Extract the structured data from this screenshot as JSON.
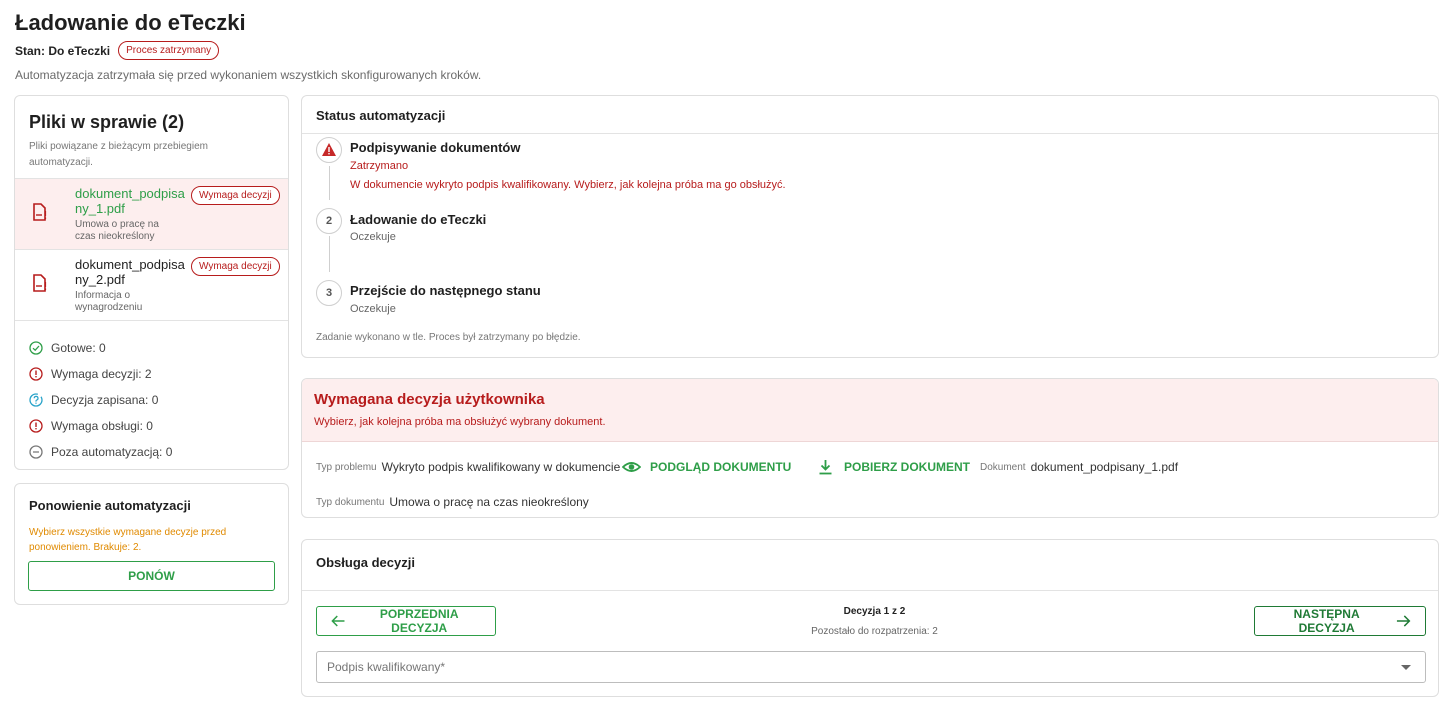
{
  "header": {
    "title": "Ładowanie do eTeczki",
    "state_label": "Stan: Do eTeczki",
    "state_chip": "Proces zatrzymany",
    "subtitle": "Automatyzacja zatrzymała się przed wykonaniem wszystkich skonfigurowanych kroków."
  },
  "files": {
    "title": "Pliki w sprawie (2)",
    "description": "Pliki powiązane z bieżącym przebiegiem automatyzacji.",
    "items": [
      {
        "name": "dokument_podpisany_1.pdf",
        "description": "Umowa o pracę na czas nieokreślony",
        "badge": "Wymaga decyzji",
        "icon": "pdf-error-icon"
      },
      {
        "name": "dokument_podpisany_2.pdf",
        "description": "Informacja o wynagrodzeniu",
        "badge": "Wymaga decyzji",
        "icon": "pdf-error-icon"
      }
    ],
    "stats": [
      {
        "label": "Gotowe: 0",
        "icon": "check-circle-icon",
        "color": "#2e9e48"
      },
      {
        "label": "Wymaga decyzji: 2",
        "icon": "alert-circle-icon",
        "color": "#b71c1c"
      },
      {
        "label": "Decyzja zapisana: 0",
        "icon": "question-circle-icon",
        "color": "#29a3c9"
      },
      {
        "label": "Wymaga obsługi: 0",
        "icon": "alert-circle-icon",
        "color": "#b71c1c"
      },
      {
        "label": "Poza automatyzacją: 0",
        "icon": "minus-circle-icon",
        "color": "#777777"
      }
    ]
  },
  "retry": {
    "title": "Ponowienie automatyzacji",
    "note": "Wybierz wszystkie wymagane decyzje przed ponowieniem. Brakuje: 2.",
    "button": "PONÓW"
  },
  "status": {
    "title": "Status automatyzacji",
    "steps": [
      {
        "marker": "!",
        "title": "Podpisywanie dokumentów",
        "status": "Zatrzymano",
        "detail": "W dokumencie wykryto podpis kwalifikowany. Wybierz, jak kolejna próba ma go obsłużyć."
      },
      {
        "marker": "2",
        "title": "Ładowanie do eTeczki",
        "status": "Oczekuje"
      },
      {
        "marker": "3",
        "title": "Przejście do następnego stanu",
        "status": "Oczekuje"
      }
    ],
    "footer": "Zadanie wykonano w tle. Proces był zatrzymany po błędzie."
  },
  "decision": {
    "title": "Wymagana decyzja użytkownika",
    "description": "Wybierz, jak kolejna próba ma obsłużyć wybrany dokument.",
    "problem_label": "Typ problemu",
    "problem_value": "Wykryto podpis kwalifikowany w dokumencie",
    "preview_button": "PODGLĄD DOKUMENTU",
    "download_button": "POBIERZ DOKUMENT",
    "document_label": "Dokument",
    "document_value": "dokument_podpisany_1.pdf",
    "doctype_label": "Typ dokumentu",
    "doctype_value": "Umowa o pracę na czas nieokreślony"
  },
  "handling": {
    "title": "Obsługa decyzji",
    "prev_button": "POPRZEDNIA DECYZJA",
    "next_button": "NASTĘPNA DECYZJA",
    "pager": "Decyzja 1 z 2",
    "remaining": "Pozostało do rozpatrzenia: 2",
    "select_placeholder": "Podpis kwalifikowany*"
  },
  "colors": {
    "accent_green": "#2e9e48",
    "error_red": "#b71c1c",
    "warning_orange": "#e08a00",
    "error_bg": "#fdeeee"
  }
}
